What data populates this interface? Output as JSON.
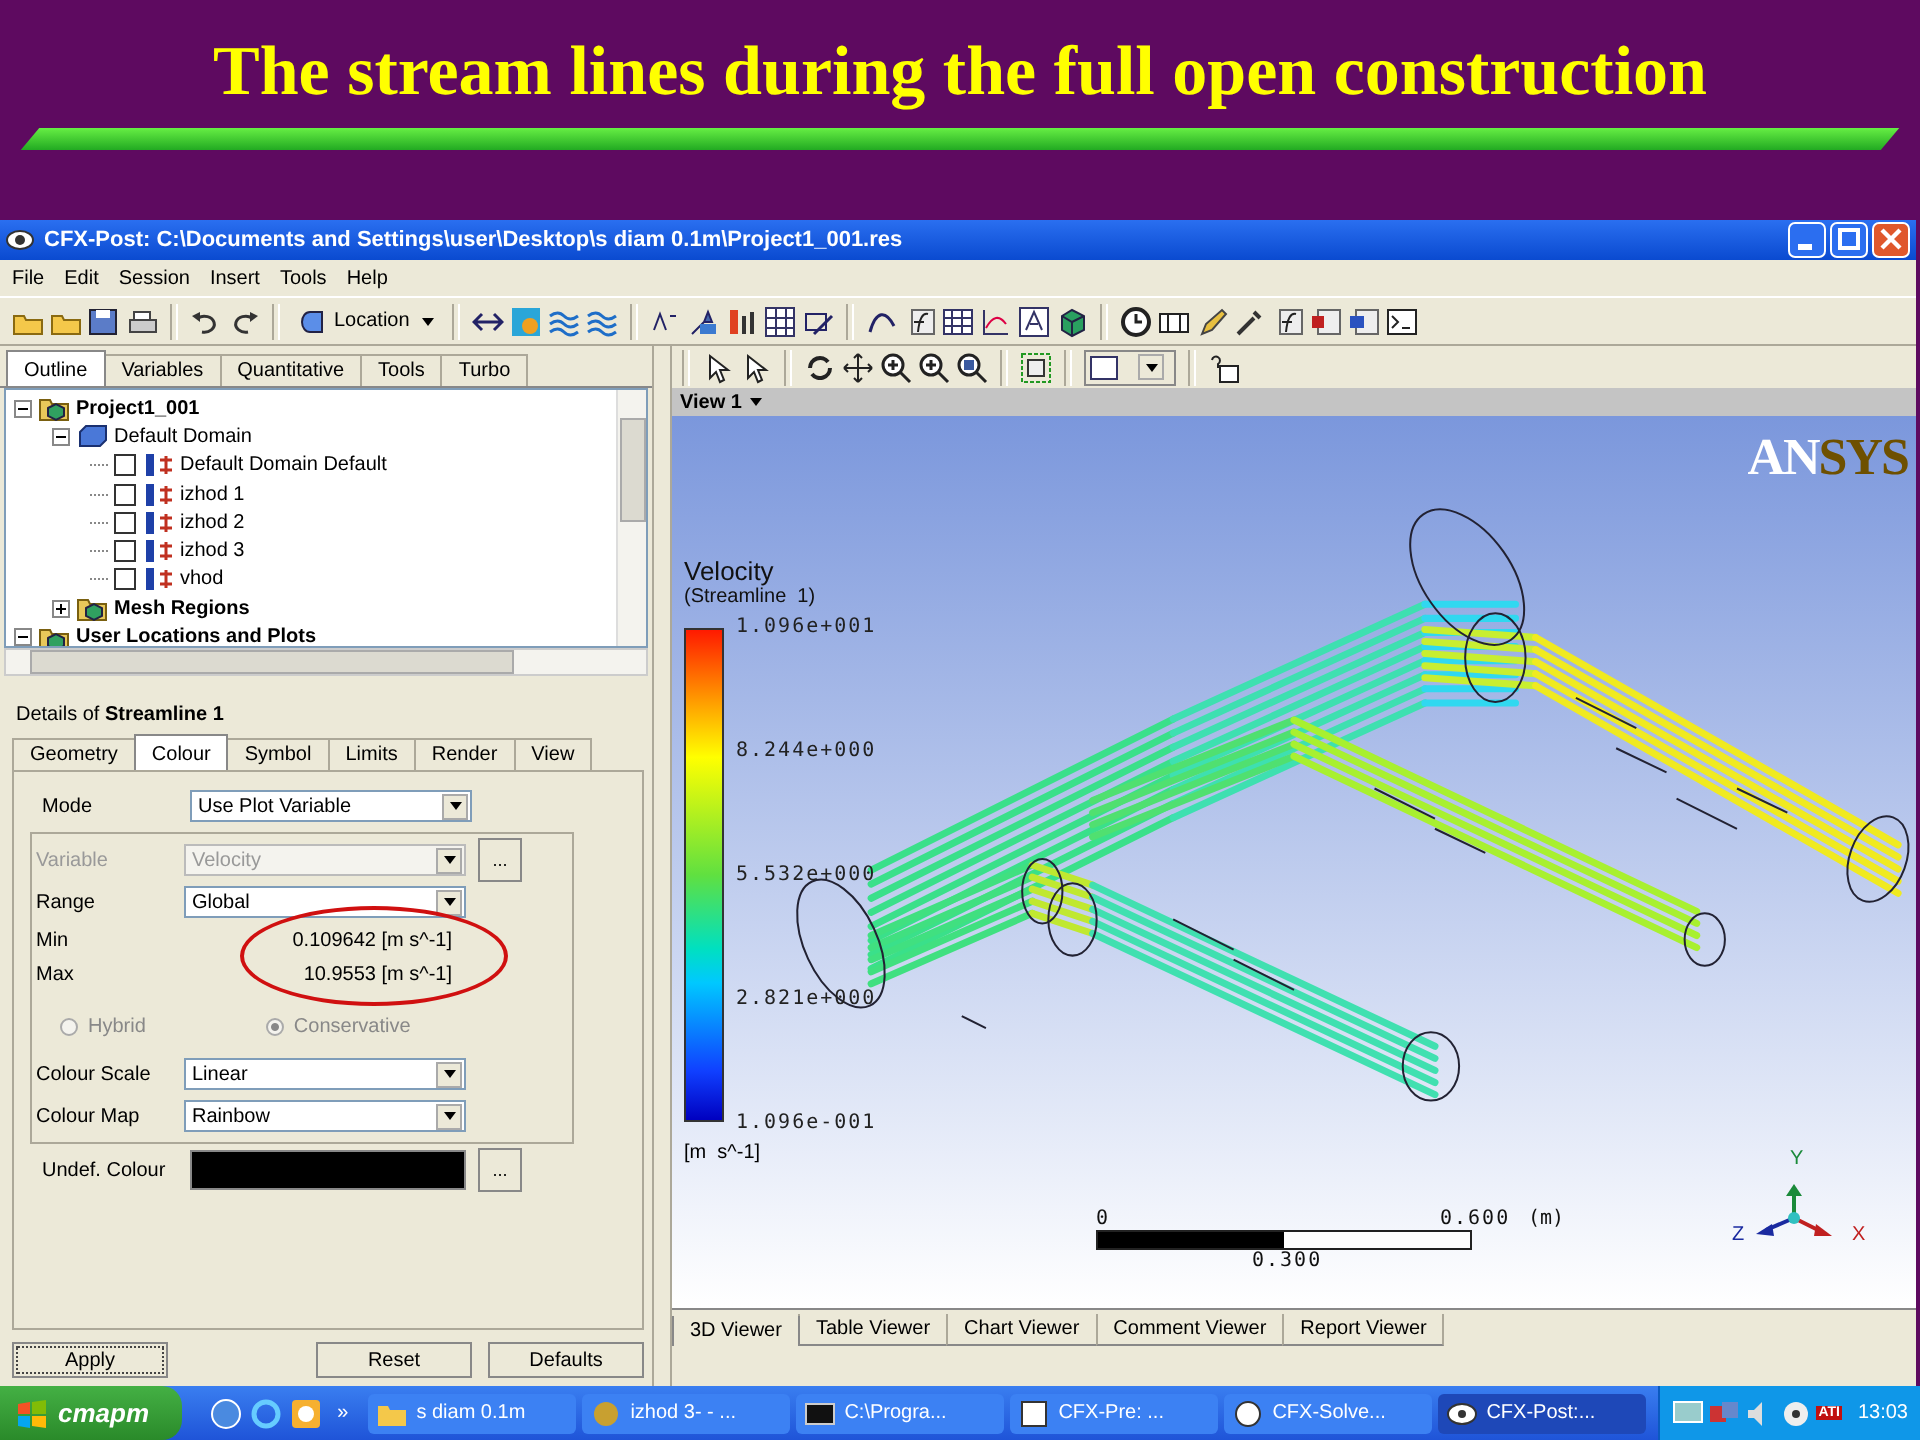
{
  "slide": {
    "title": "The stream lines during the full open construction"
  },
  "window": {
    "title": "CFX-Post: C:\\Documents and Settings\\user\\Desktop\\s diam 0.1m\\Project1_001.res",
    "menu": [
      "File",
      "Edit",
      "Session",
      "Insert",
      "Tools",
      "Help"
    ],
    "location_button": "Location"
  },
  "outline": {
    "tabs": [
      {
        "label": "Outline",
        "selected": true
      },
      {
        "label": "Variables",
        "selected": false
      },
      {
        "label": "Quantitative",
        "selected": false
      },
      {
        "label": "Tools",
        "selected": false
      },
      {
        "label": "Turbo",
        "selected": false
      }
    ],
    "tree": [
      {
        "kind": "folder",
        "label": "Project1_001",
        "expanded": true,
        "children": [
          {
            "kind": "domain",
            "label": "Default Domain",
            "expanded": true,
            "children": [
              {
                "kind": "boundary",
                "label": "Default Domain Default",
                "checked": false
              },
              {
                "kind": "boundary",
                "label": "izhod 1",
                "checked": false
              },
              {
                "kind": "boundary",
                "label": "izhod 2",
                "checked": false
              },
              {
                "kind": "boundary",
                "label": "izhod 3",
                "checked": false
              },
              {
                "kind": "boundary",
                "label": "vhod",
                "checked": false
              }
            ]
          },
          {
            "kind": "folder",
            "label": "Mesh Regions",
            "expanded": false
          }
        ]
      },
      {
        "kind": "folder",
        "label": "User Locations and Plots",
        "expanded": true
      }
    ]
  },
  "details": {
    "title": "Details of **Streamline 1**",
    "tabs": [
      {
        "label": "Geometry",
        "selected": false
      },
      {
        "label": "Colour",
        "selected": true
      },
      {
        "label": "Symbol",
        "selected": false
      },
      {
        "label": "Limits",
        "selected": false
      },
      {
        "label": "Render",
        "selected": false
      },
      {
        "label": "View",
        "selected": false
      }
    ],
    "mode": {
      "label": "Mode",
      "value": "Use Plot Variable"
    },
    "group_rows": [
      {
        "kind": "select",
        "label": "Variable",
        "value": "Velocity",
        "disabled": true,
        "more": "..."
      },
      {
        "kind": "select",
        "label": "Range",
        "value": "Global",
        "disabled": false
      },
      {
        "kind": "reading",
        "label": "Min",
        "value": "0.109642 [m s^-1]"
      },
      {
        "kind": "reading",
        "label": "Max",
        "value": "10.9553 [m s^-1]"
      },
      {
        "kind": "radios",
        "options": [
          {
            "label": "Hybrid",
            "selected": false,
            "disabled": true
          },
          {
            "label": "Conservative",
            "selected": true,
            "disabled": true
          }
        ]
      },
      {
        "kind": "select",
        "label": "Colour Scale",
        "value": "Linear",
        "disabled": false
      },
      {
        "kind": "select",
        "label": "Colour Map",
        "value": "Rainbow",
        "disabled": false
      }
    ],
    "undef": {
      "label": "Undef. Colour",
      "more": "..."
    },
    "buttons": [
      "Apply",
      "Reset",
      "Defaults"
    ]
  },
  "viewer": {
    "view_label": "View 1",
    "logo": [
      "AN",
      "SYS"
    ],
    "legend": {
      "title": "Velocity",
      "subtitle": "(Streamline  1)",
      "ticks": [
        "1.096e+001",
        "8.244e+000",
        "5.532e+000",
        "2.821e+000",
        "1.096e-001"
      ],
      "unit": "[m  s^-1]"
    },
    "scale": {
      "start": "0",
      "end": "0.600",
      "unit": "(m)",
      "middle": "0.300"
    },
    "axes": {
      "y": "Y",
      "z": "Z",
      "x": "X"
    },
    "tabs": [
      {
        "label": "3D Viewer",
        "selected": true
      },
      {
        "label": "Table Viewer",
        "selected": false
      },
      {
        "label": "Chart Viewer",
        "selected": false
      },
      {
        "label": "Comment Viewer",
        "selected": false
      },
      {
        "label": "Report Viewer",
        "selected": false
      }
    ]
  },
  "taskbar": {
    "start": "старт",
    "more": "»",
    "tasks": [
      {
        "label": "s diam 0.1m",
        "selected": false
      },
      {
        "label": "izhod 3- - ...",
        "selected": false
      },
      {
        "label": "C:\\Progra...",
        "selected": false
      },
      {
        "label": "CFX-Pre: ...",
        "selected": false
      },
      {
        "label": "CFX-Solve...",
        "selected": false
      },
      {
        "label": "CFX-Post:...",
        "selected": true
      }
    ],
    "tray_badge": "ATI",
    "time": "13:03"
  }
}
